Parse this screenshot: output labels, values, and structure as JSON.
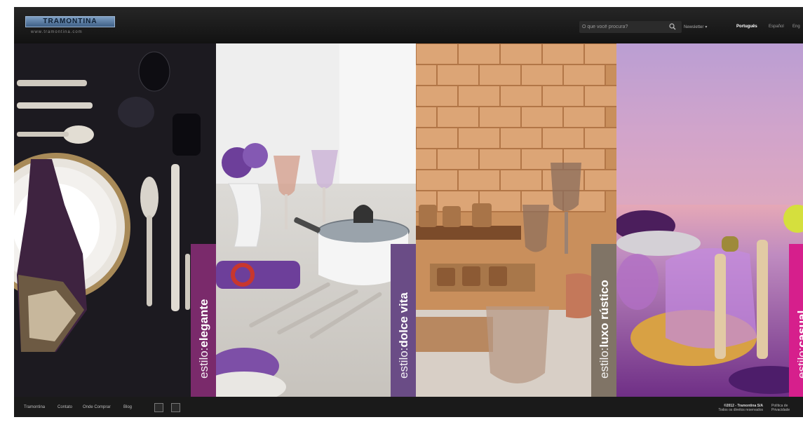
{
  "header": {
    "logo": "TRAMONTINA",
    "tagline": "www.tramontina.com",
    "search_placeholder": "O que você procura?",
    "newsletter": "Newsletter",
    "languages": [
      "Português",
      "Español",
      "Eng"
    ]
  },
  "panels": [
    {
      "prefix": "estilo",
      "name": "elegante",
      "banner_color": "#7a2a6b"
    },
    {
      "prefix": "estilo",
      "name": "dolce vita",
      "banner_color": "#6a4c86"
    },
    {
      "prefix": "estilo",
      "name": "luxo rústico",
      "banner_color": "#807466"
    },
    {
      "prefix": "estilo",
      "name": "casual",
      "banner_color": "#d61f8c"
    }
  ],
  "footer": {
    "links": [
      "Tramontina",
      "Contato",
      "Onde Comprar",
      "Blog"
    ],
    "copyright_line1": "©2012 - Tramontina S/A",
    "copyright_line2": "Todos os direitos reservados",
    "policy_line1": "Política de",
    "policy_line2": "Privacidade"
  }
}
